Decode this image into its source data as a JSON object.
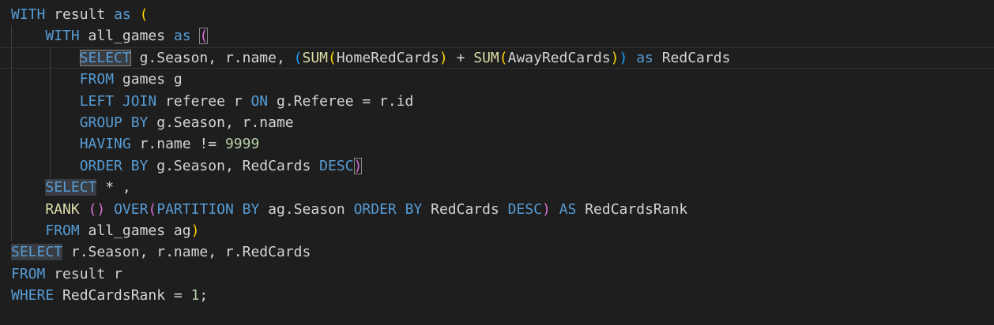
{
  "editor": {
    "language": "sql",
    "colors": {
      "background": "#1e1e1e",
      "keyword": "#569cd6",
      "function": "#dcdcaa",
      "number": "#b5cea8",
      "text": "#d4d4d4",
      "bracket_level_1": "#ffd700",
      "bracket_level_2": "#da70d6",
      "bracket_level_3": "#179fff"
    },
    "lines": [
      [
        {
          "t": "WITH",
          "c": "kw"
        },
        {
          "t": " result "
        },
        {
          "t": "as",
          "c": "kw"
        },
        {
          "t": " "
        },
        {
          "t": "(",
          "c": "b1"
        }
      ],
      [
        {
          "t": "    "
        },
        {
          "t": "WITH",
          "c": "kw"
        },
        {
          "t": " all_games "
        },
        {
          "t": "as",
          "c": "kw"
        },
        {
          "t": " "
        },
        {
          "t": "(",
          "c": "b2 match"
        }
      ],
      [
        {
          "t": "        "
        },
        {
          "t": "SELECT",
          "c": "kw hl match"
        },
        {
          "t": " g.Season, r.name, "
        },
        {
          "t": "(",
          "c": "b3"
        },
        {
          "t": "SUM",
          "c": "fn"
        },
        {
          "t": "(",
          "c": "b1"
        },
        {
          "t": "HomeRedCards"
        },
        {
          "t": ")",
          "c": "b1"
        },
        {
          "t": " + "
        },
        {
          "t": "SUM",
          "c": "fn"
        },
        {
          "t": "(",
          "c": "b1"
        },
        {
          "t": "AwayRedCards"
        },
        {
          "t": ")",
          "c": "b1"
        },
        {
          "t": ")",
          "c": "b3"
        },
        {
          "t": " "
        },
        {
          "t": "as",
          "c": "kw"
        },
        {
          "t": " RedCards"
        }
      ],
      [
        {
          "t": "        "
        },
        {
          "t": "FROM",
          "c": "kw"
        },
        {
          "t": " games g"
        }
      ],
      [
        {
          "t": "        "
        },
        {
          "t": "LEFT JOIN",
          "c": "kw"
        },
        {
          "t": " referee r "
        },
        {
          "t": "ON",
          "c": "kw"
        },
        {
          "t": " g.Referee = r.id"
        }
      ],
      [
        {
          "t": "        "
        },
        {
          "t": "GROUP BY",
          "c": "kw"
        },
        {
          "t": " g.Season, r.name"
        }
      ],
      [
        {
          "t": "        "
        },
        {
          "t": "HAVING",
          "c": "kw"
        },
        {
          "t": " r.name != "
        },
        {
          "t": "9999",
          "c": "num"
        }
      ],
      [
        {
          "t": "        "
        },
        {
          "t": "ORDER BY",
          "c": "kw"
        },
        {
          "t": " g.Season, RedCards "
        },
        {
          "t": "DESC",
          "c": "kw"
        },
        {
          "t": ")",
          "c": "b2 match"
        }
      ],
      [
        {
          "t": "    "
        },
        {
          "t": "SELECT",
          "c": "kw hl"
        },
        {
          "t": " * ,"
        }
      ],
      [
        {
          "t": "    "
        },
        {
          "t": "RANK",
          "c": "fn"
        },
        {
          "t": " "
        },
        {
          "t": "()",
          "c": "b2"
        },
        {
          "t": " "
        },
        {
          "t": "OVER",
          "c": "kw"
        },
        {
          "t": "(",
          "c": "b2"
        },
        {
          "t": "PARTITION BY",
          "c": "kw"
        },
        {
          "t": " ag.Season "
        },
        {
          "t": "ORDER BY",
          "c": "kw"
        },
        {
          "t": " RedCards "
        },
        {
          "t": "DESC",
          "c": "kw"
        },
        {
          "t": ")",
          "c": "b2"
        },
        {
          "t": " "
        },
        {
          "t": "AS",
          "c": "kw"
        },
        {
          "t": " RedCardsRank"
        }
      ],
      [
        {
          "t": "    "
        },
        {
          "t": "FROM",
          "c": "kw"
        },
        {
          "t": " all_games ag"
        },
        {
          "t": ")",
          "c": "b1"
        }
      ],
      [
        {
          "t": "SELECT",
          "c": "kw hl"
        },
        {
          "t": " r.Season, r.name, r.RedCards"
        }
      ],
      [
        {
          "t": "FROM",
          "c": "kw"
        },
        {
          "t": " result r"
        }
      ],
      [
        {
          "t": "WHERE",
          "c": "kw"
        },
        {
          "t": " RedCardsRank = "
        },
        {
          "t": "1",
          "c": "num"
        },
        {
          "t": ";"
        }
      ]
    ]
  }
}
